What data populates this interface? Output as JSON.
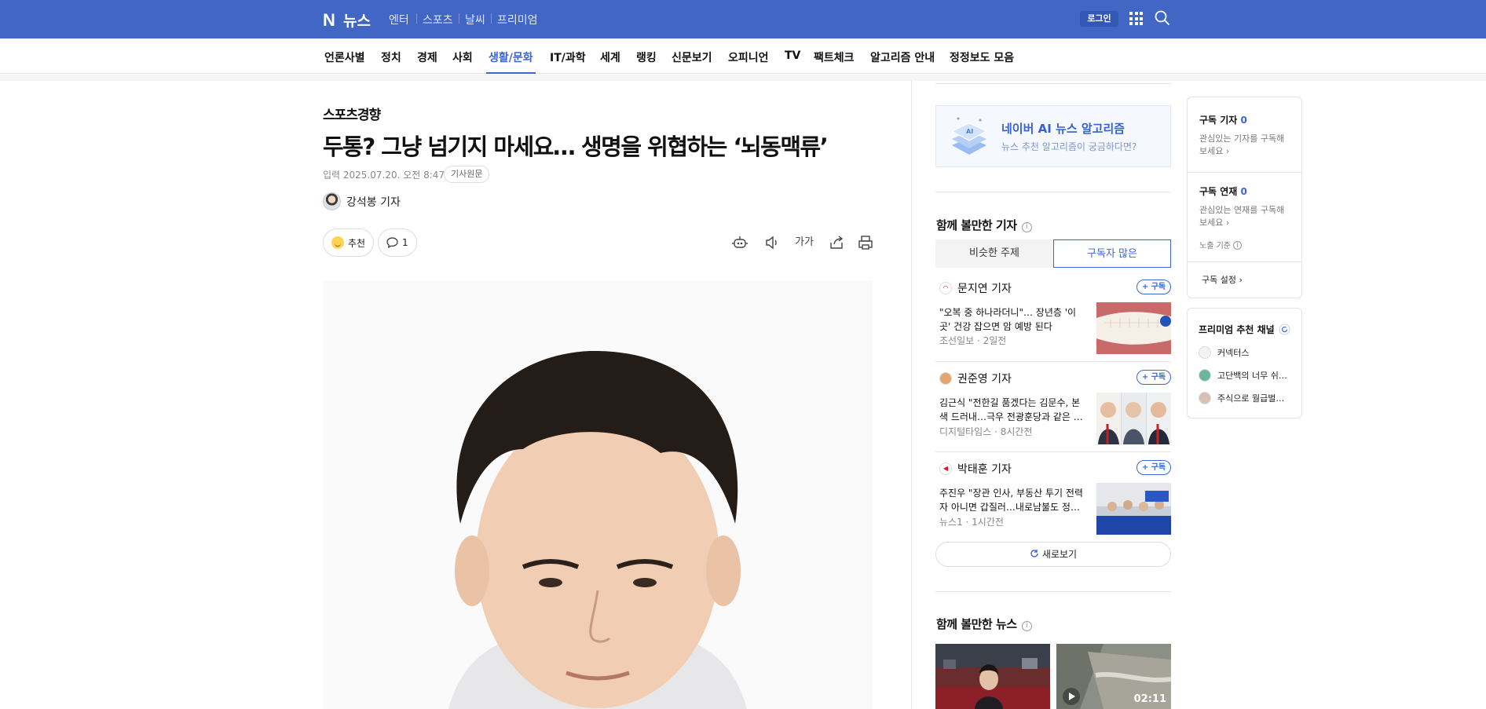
{
  "topbar": {
    "logo_text": "뉴스",
    "services": [
      "엔터",
      "스포츠",
      "날씨",
      "프리미엄"
    ],
    "login_label": "로그인"
  },
  "nav": {
    "items": [
      "언론사별",
      "정치",
      "경제",
      "사회",
      "생활/문화",
      "IT/과학",
      "세계",
      "랭킹",
      "신문보기",
      "오피니언",
      "TV",
      "팩트체크",
      "알고리즘 안내",
      "정정보도 모음"
    ],
    "active": "생활/문화"
  },
  "article": {
    "press": "스포츠경향",
    "headline": "두통? 그냥 넘기지 마세요… 생명을 위협하는 ‘뇌동맥류’",
    "date": "입력 2025.07.20. 오전 8:47",
    "origin_label": "기사원문",
    "author": "강석봉 기자",
    "recommend_label": "추천",
    "comment_count": "1",
    "font_tool": "가가"
  },
  "sidebar": {
    "ai_banner": {
      "title": "네이버 AI 뉴스 알고리즘",
      "subtitle": "뉴스 추천 알고리즘이 궁금하다면?"
    },
    "together_title": "함께 볼만한 기자",
    "tabs": [
      "비슷한 주제",
      "구독자 많은"
    ],
    "active_tab": "구독자 많은",
    "subscribe_label": "+ 구독",
    "reporters": [
      {
        "name": "문지연 기자",
        "text": "\"오복 중 하나라더니\"… 장년층 '이곳' 건강 잡으면 암 예방 된다",
        "press": "조선일보",
        "time": "2일전"
      },
      {
        "name": "권준영 기자",
        "text": "김근식 \"전한길 품겠다는 김문수, 본색 드러내…극우 전광훈당과 같은 …",
        "press": "디지털타임스",
        "time": "8시간전"
      },
      {
        "name": "박태훈 기자",
        "text": "주진우 \"장관 인사, 부동산 투기 전력자 아니면 갑질러…내로남불도 정…",
        "press": "뉴스1",
        "time": "1시간전"
      }
    ],
    "refresh_label": "새로보기",
    "news_title": "함께 볼만한 뉴스",
    "video_duration": "02:11"
  },
  "right": {
    "sub_reporter_title": "구독 기자",
    "sub_reporter_count": "0",
    "sub_reporter_desc": "관심있는 기자를 구독해보세요",
    "sub_series_title": "구독 연재",
    "sub_series_count": "0",
    "sub_series_desc": "관심있는 연재를 구독해보세요",
    "exposure_label": "노출 기준",
    "settings_label": "구독 설정",
    "premium_title": "프리미엄 추천 채널",
    "channels": [
      "커넥터스",
      "고단백의 너무 쉬…",
      "주식으로 월급벌…"
    ]
  }
}
